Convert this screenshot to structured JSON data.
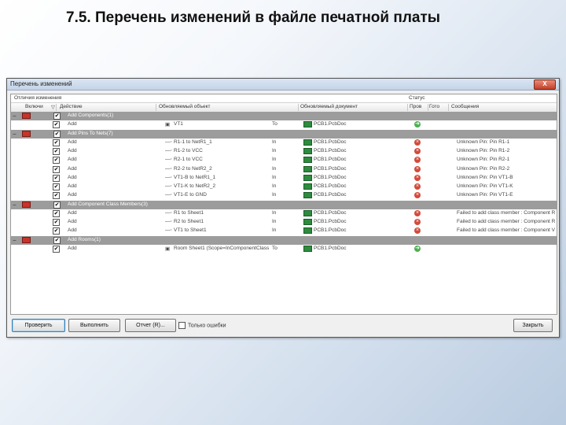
{
  "slide": {
    "title": "7.5. Перечень изменений в файле печатной платы"
  },
  "dialog": {
    "title": "Перечень изменений",
    "close_label": "X"
  },
  "groups": {
    "changes": "Отличия изменения",
    "status": "Статус"
  },
  "columns": {
    "enable": "Включи",
    "action": "Действие",
    "object": "Обновляемый объект",
    "doc": "Обновляемый документ",
    "check": "Пров",
    "done": "Гото",
    "message": "Сообщения"
  },
  "rows": [
    {
      "type": "group",
      "label": "Add Components(1)"
    },
    {
      "type": "item",
      "action": "Add",
      "object": "VT1",
      "to": "To",
      "doc": "PCB1.PcbDoc",
      "status": "ok",
      "message": ""
    },
    {
      "type": "group",
      "label": "Add Pins To Nets(7)"
    },
    {
      "type": "item",
      "action": "Add",
      "object": "R1-1 to NetR1_1",
      "to": "In",
      "doc": "PCB1.PcbDoc",
      "status": "err",
      "message": "Unknown Pin: Pin R1-1"
    },
    {
      "type": "item",
      "action": "Add",
      "object": "R1-2 to VCC",
      "to": "In",
      "doc": "PCB1.PcbDoc",
      "status": "err",
      "message": "Unknown Pin: Pin R1-2"
    },
    {
      "type": "item",
      "action": "Add",
      "object": "R2-1 to VCC",
      "to": "In",
      "doc": "PCB1.PcbDoc",
      "status": "err",
      "message": "Unknown Pin: Pin R2-1"
    },
    {
      "type": "item",
      "action": "Add",
      "object": "R2-2 to NetR2_2",
      "to": "In",
      "doc": "PCB1.PcbDoc",
      "status": "err",
      "message": "Unknown Pin: Pin R2-2"
    },
    {
      "type": "item",
      "action": "Add",
      "object": "VT1-B to NetR1_1",
      "to": "In",
      "doc": "PCB1.PcbDoc",
      "status": "err",
      "message": "Unknown Pin: Pin VT1-B"
    },
    {
      "type": "item",
      "action": "Add",
      "object": "VT1-K to NetR2_2",
      "to": "In",
      "doc": "PCB1.PcbDoc",
      "status": "err",
      "message": "Unknown Pin: Pin VT1-K"
    },
    {
      "type": "item",
      "action": "Add",
      "object": "VT1-E to GND",
      "to": "In",
      "doc": "PCB1.PcbDoc",
      "status": "err",
      "message": "Unknown Pin: Pin VT1-E"
    },
    {
      "type": "group",
      "label": "Add Component Class Members(3)"
    },
    {
      "type": "item",
      "action": "Add",
      "object": "R1 to Sheet1",
      "to": "In",
      "doc": "PCB1.PcbDoc",
      "status": "err",
      "message": "Failed to add class member : Component R"
    },
    {
      "type": "item",
      "action": "Add",
      "object": "R2 to Sheet1",
      "to": "In",
      "doc": "PCB1.PcbDoc",
      "status": "err",
      "message": "Failed to add class member : Component R"
    },
    {
      "type": "item",
      "action": "Add",
      "object": "VT1 to Sheet1",
      "to": "In",
      "doc": "PCB1.PcbDoc",
      "status": "err",
      "message": "Failed to add class member : Component V"
    },
    {
      "type": "group",
      "label": "Add Rooms(1)"
    },
    {
      "type": "item",
      "action": "Add",
      "object": "Room Sheet1 (Scope=InComponentClass",
      "to": "To",
      "doc": "PCB1.PcbDoc",
      "status": "ok",
      "message": ""
    }
  ],
  "buttons": {
    "validate": "Проверить",
    "execute": "Выполнить",
    "report": "Отчет (R)...",
    "only_errors": "Только ошибки",
    "close": "Закрыть"
  },
  "colors": {
    "group_row": "#9c9c9c",
    "ok": "#4caf50",
    "error": "#d44a3a",
    "doc_icon": "#2e8b3f",
    "folder": "#c8332b"
  }
}
